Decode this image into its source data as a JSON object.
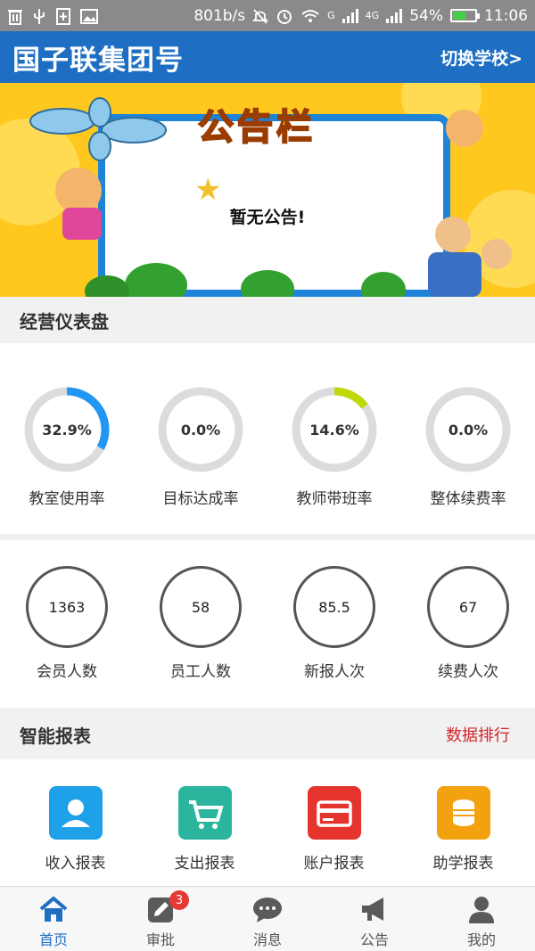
{
  "status_bar": {
    "speed": "801b/s",
    "network": "G",
    "network2": "4G",
    "battery": "54%",
    "time": "11:06",
    "icons": [
      "trash-icon",
      "usb-icon",
      "sim-add-icon",
      "image-icon",
      "mute-icon",
      "alarm-icon",
      "wifi-icon",
      "signal-icon",
      "battery-icon"
    ]
  },
  "header": {
    "title": "国子联集团号",
    "switch_label": "切换学校>"
  },
  "banner": {
    "title": "公告栏",
    "notice": "暂无公告!"
  },
  "dashboard": {
    "title": "经营仪表盘",
    "rings": [
      {
        "value": "32.9%",
        "percent": 32.9,
        "color": "#2196f3",
        "label": "教室使用率"
      },
      {
        "value": "0.0%",
        "percent": 0.0,
        "color": "#2196f3",
        "label": "目标达成率"
      },
      {
        "value": "14.6%",
        "percent": 14.6,
        "color": "#c0d70a",
        "label": "教师带班率"
      },
      {
        "value": "0.0%",
        "percent": 0.0,
        "color": "#2196f3",
        "label": "整体续费率"
      }
    ],
    "stats": [
      {
        "value": "1363",
        "label": "会员人数"
      },
      {
        "value": "58",
        "label": "员工人数"
      },
      {
        "value": "85.5",
        "label": "新报人次"
      },
      {
        "value": "67",
        "label": "续费人次"
      }
    ]
  },
  "reports": {
    "title": "智能报表",
    "ranking_link": "数据排行",
    "items": [
      {
        "label": "收入报表",
        "icon": "user-icon",
        "color": "#1ea1e8"
      },
      {
        "label": "支出报表",
        "icon": "cart-icon",
        "color": "#2cb59e"
      },
      {
        "label": "账户报表",
        "icon": "card-icon",
        "color": "#e5342e"
      },
      {
        "label": "助学报表",
        "icon": "coins-icon",
        "color": "#f2a10f"
      }
    ]
  },
  "tabbar": {
    "items": [
      {
        "label": "首页",
        "icon": "home-icon",
        "active": true
      },
      {
        "label": "审批",
        "icon": "edit-icon",
        "badge": "3"
      },
      {
        "label": "消息",
        "icon": "chat-icon"
      },
      {
        "label": "公告",
        "icon": "megaphone-icon"
      },
      {
        "label": "我的",
        "icon": "person-icon"
      }
    ]
  }
}
